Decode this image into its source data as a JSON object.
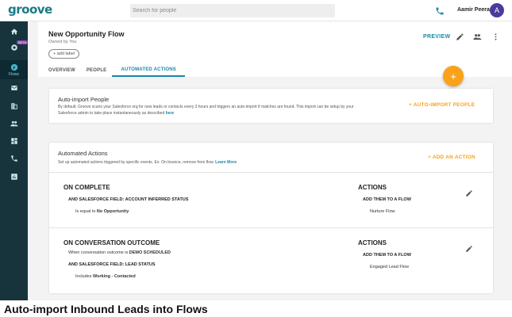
{
  "app": {
    "logo": "groove"
  },
  "topbar": {
    "search_placeholder": "Search for people",
    "user_name": "Aamir Peeran",
    "avatar_initial": "A",
    "phone_icon": "phone-icon"
  },
  "rail": {
    "items": [
      {
        "icon": "home-icon"
      },
      {
        "icon": "analytics-icon",
        "badge": "BETA"
      },
      {
        "icon": "flows-icon",
        "label": "Flows"
      },
      {
        "icon": "mail-icon"
      },
      {
        "icon": "building-icon"
      },
      {
        "icon": "people-icon"
      },
      {
        "icon": "dashboard-icon"
      },
      {
        "icon": "phone-icon"
      },
      {
        "icon": "chart-icon"
      }
    ]
  },
  "header": {
    "title": "New Opportunity Flow",
    "owner": "Owned by You",
    "add_label": "+ add label",
    "preview": "PREVIEW",
    "tabs": [
      {
        "label": "OVERVIEW"
      },
      {
        "label": "PEOPLE"
      },
      {
        "label": "AUTOMATED ACTIONS"
      }
    ],
    "active_tab": "AUTOMATED ACTIONS"
  },
  "fab": {
    "label": "+"
  },
  "auto_import": {
    "title": "Auto-import People",
    "desc_1": "By default, Groove scans your Salesforce org for new leads or contacts every 3 hours and triggers an auto-import if matches are found. This import can be setup by your",
    "desc_2": "Salesforce admin to take place instantaneously as described",
    "desc_link": "here",
    "button": "+ AUTO-IMPORT PEOPLE"
  },
  "automated_actions": {
    "title": "Automated Actions",
    "desc": "Set up automated actions triggered by specific events. Ex: On bounce, remove from flow.",
    "learn_more": "Learn More",
    "add_button": "+ ADD AN ACTION",
    "rules": [
      {
        "heading": "ON COMPLETE",
        "condition_line": "AND SALESFORCE FIELD: ACCOUNT INFERRED STATUS",
        "condition_prefix": "Is equal to",
        "condition_value": "No Opportunity",
        "actions_heading": "ACTIONS",
        "action": "ADD THEM TO A FLOW",
        "action_target": "Nurture Flow"
      },
      {
        "heading": "ON CONVERSATION OUTCOME",
        "when_prefix": "When conversation outcome is",
        "when_value": "DEMO SCHEDULED",
        "condition_line": "AND SALESFORCE FIELD: LEAD STATUS",
        "condition_prefix": "Includes",
        "condition_value": "Working - Contacted",
        "actions_heading": "ACTIONS",
        "action": "ADD THEM TO A FLOW",
        "action_target": "Engaged Lead Flow"
      }
    ]
  },
  "caption": "Auto-import Inbound Leads into Flows",
  "colors": {
    "accent": "#1a88a5",
    "orange": "#f9a21a",
    "rail": "#17343d",
    "avatar": "#4b3a9c"
  }
}
